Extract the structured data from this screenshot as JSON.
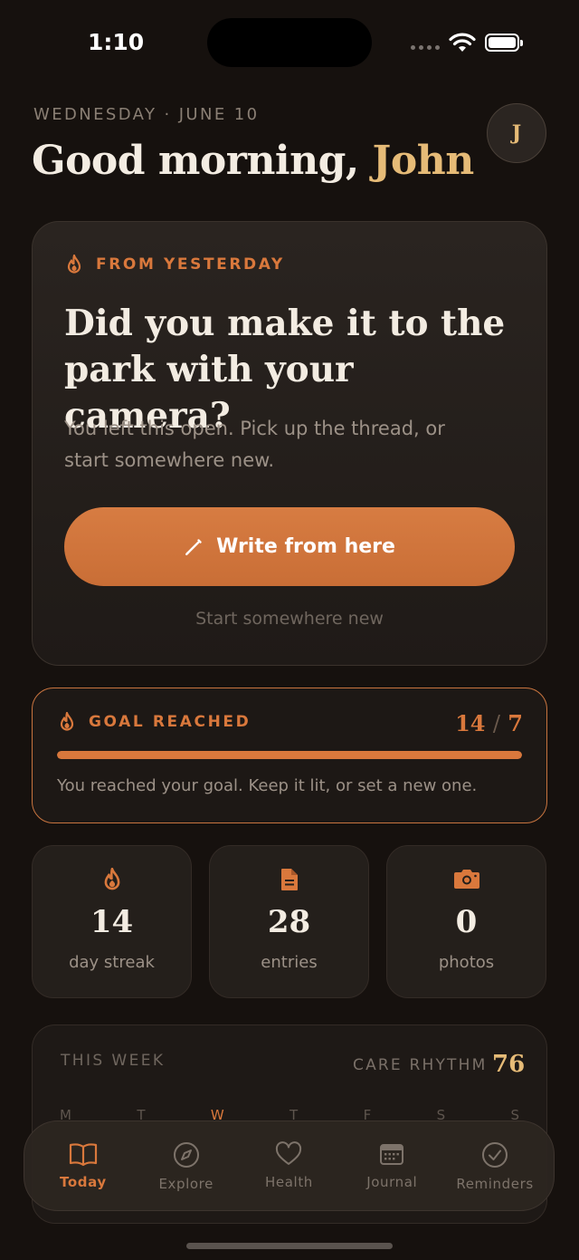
{
  "status_bar": {
    "time": "1:10"
  },
  "header": {
    "date": "WEDNESDAY · JUNE 10",
    "greeting": "Good morning, ",
    "name": "John",
    "avatar_initial": "J"
  },
  "prompt_card": {
    "eyebrow": "FROM YESTERDAY",
    "eyebrow_icon": "flame-icon",
    "question": "Did you make it to the park with your camera?",
    "subtitle": "You left this open. Pick up the thread, or start somewhere new.",
    "primary_button": "Write from here",
    "primary_icon": "pencil-icon",
    "secondary_link": "Start somewhere new"
  },
  "goal_card": {
    "eyebrow": "GOAL REACHED",
    "current": "14",
    "separator": "/",
    "target": "7",
    "progress": 1.0,
    "message": "You reached your goal. Keep it lit, or set a new one."
  },
  "stats": [
    {
      "icon": "flame-icon",
      "value": "14",
      "label": "day streak"
    },
    {
      "icon": "document-icon",
      "value": "28",
      "label": "entries"
    },
    {
      "icon": "camera-icon",
      "value": "0",
      "label": "photos"
    }
  ],
  "week": {
    "title": "THIS WEEK",
    "rhythm_label": "CARE RHYTHM",
    "rhythm_value": "76",
    "days": [
      "M",
      "T",
      "W",
      "T",
      "F",
      "S",
      "S"
    ],
    "today_index": 2
  },
  "tabs": [
    {
      "label": "Today",
      "icon": "book-icon",
      "active": true
    },
    {
      "label": "Explore",
      "icon": "compass-icon",
      "active": false
    },
    {
      "label": "Health",
      "icon": "heart-icon",
      "active": false
    },
    {
      "label": "Journal",
      "icon": "calendar-icon",
      "active": false
    },
    {
      "label": "Reminders",
      "icon": "check-circle-icon",
      "active": false
    }
  ],
  "colors": {
    "background": "#16110e",
    "accent": "#d9783c",
    "gold": "#e6bb77"
  }
}
